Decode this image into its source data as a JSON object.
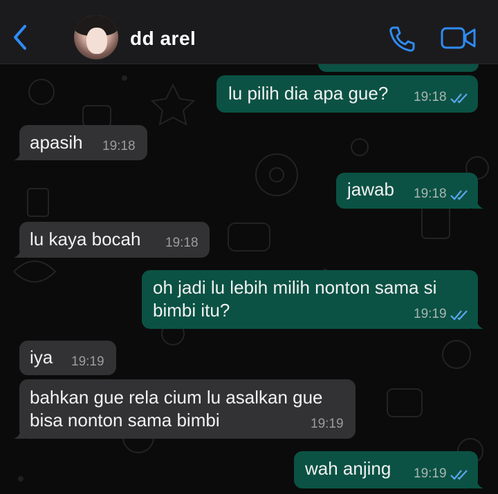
{
  "header": {
    "contact_name": "dd arel",
    "back_icon": "chevron-left-icon",
    "call_icon": "phone-icon",
    "video_icon": "video-camera-icon",
    "accent_color": "#2f8cf5"
  },
  "messages": [
    {
      "direction": "outgoing",
      "text": "lu pilih dia apa gue?",
      "time": "19:18",
      "status": "read"
    },
    {
      "direction": "incoming",
      "text": "apasih",
      "time": "19:18"
    },
    {
      "direction": "outgoing",
      "text": "jawab",
      "time": "19:18",
      "status": "read"
    },
    {
      "direction": "incoming",
      "text": "lu kaya bocah",
      "time": "19:18"
    },
    {
      "direction": "outgoing",
      "lines": [
        "oh jadi lu lebih milih nonton sama si",
        "bimbi itu?"
      ],
      "time": "19:19",
      "status": "read"
    },
    {
      "direction": "incoming",
      "text": "iya",
      "time": "19:19"
    },
    {
      "direction": "incoming",
      "lines": [
        "bahkan gue rela cium lu asalkan gue",
        "bisa nonton sama bimbi"
      ],
      "time": "19:19"
    },
    {
      "direction": "outgoing",
      "text": "wah anjing",
      "time": "19:19",
      "status": "read"
    }
  ],
  "colors": {
    "outgoing_bubble": "#0b5244",
    "incoming_bubble": "#323234",
    "read_ticks": "#5aa7ef",
    "background": "#0b0b0b"
  }
}
